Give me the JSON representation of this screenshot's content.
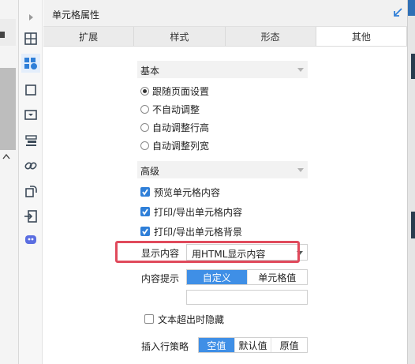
{
  "panel": {
    "title": "单元格属性"
  },
  "tabs": [
    "扩展",
    "样式",
    "形态",
    "其他"
  ],
  "active_tab": 3,
  "basic": {
    "title": "基本",
    "options": [
      "跟随页面设置",
      "不自动调整",
      "自动调整行高",
      "自动调整列宽"
    ],
    "selected": 0
  },
  "advanced": {
    "title": "高级",
    "checks": [
      {
        "label": "预览单元格内容",
        "checked": true
      },
      {
        "label": "打印/导出单元格内容",
        "checked": true
      },
      {
        "label": "打印/导出单元格背景",
        "checked": true
      }
    ],
    "display_content": {
      "label": "显示内容",
      "value": "用HTML显示内容"
    },
    "content_tip": {
      "label": "内容提示",
      "options": [
        "自定义",
        "单元格值"
      ],
      "selected": 0,
      "input_value": ""
    },
    "hide_overflow": {
      "label": "文本超出时隐藏",
      "checked": false
    },
    "insert_policy": {
      "label": "插入行策略",
      "options": [
        "空值",
        "默认值",
        "原值"
      ],
      "selected": 0
    }
  },
  "colors": {
    "accent": "#3f8fe6",
    "checkbox": "#2f7fd8",
    "highlight": "#e04a5c"
  },
  "icons": [
    "expand-arrow-icon",
    "cell-grid-icon",
    "cell-properties-icon",
    "float-element-icon",
    "widget-icon",
    "condition-attribute-icon",
    "hyperlink-icon",
    "data-column-icon",
    "embed-icon",
    "plugin-icon",
    "collapse-panel-icon"
  ]
}
